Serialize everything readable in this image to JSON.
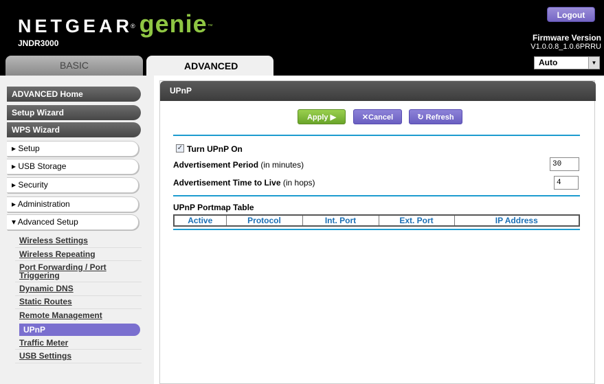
{
  "header": {
    "logo_brand": "NETGEAR",
    "logo_product": "genie",
    "model": "JNDR3000",
    "logout_label": "Logout",
    "firmware_label": "Firmware Version",
    "firmware_value": "V1.0.0.8_1.0.6PRRU",
    "tabs": [
      {
        "label": "BASIC",
        "active": false
      },
      {
        "label": "ADVANCED",
        "active": true
      }
    ],
    "language_selected": "Auto"
  },
  "sidebar": {
    "top_items": [
      {
        "label": "ADVANCED Home"
      },
      {
        "label": "Setup Wizard"
      },
      {
        "label": "WPS Wizard"
      }
    ],
    "sections": [
      {
        "label": "▸ Setup"
      },
      {
        "label": "▸ USB Storage"
      },
      {
        "label": "▸ Security"
      },
      {
        "label": "▸ Administration"
      },
      {
        "label": "▾ Advanced Setup"
      }
    ],
    "subitems": [
      {
        "label": "Wireless Settings"
      },
      {
        "label": "Wireless Repeating"
      },
      {
        "label": "Port Forwarding / Port Triggering"
      },
      {
        "label": "Dynamic DNS"
      },
      {
        "label": "Static Routes"
      },
      {
        "label": "Remote Management"
      },
      {
        "label": "UPnP"
      },
      {
        "label": "Traffic Meter"
      },
      {
        "label": "USB Settings"
      }
    ],
    "active_subitem": "UPnP"
  },
  "main": {
    "title": "UPnP",
    "apply_label": "Apply ▶",
    "cancel_label": "✕Cancel",
    "refresh_label": "↻ Refresh",
    "turn_on_label": "Turn UPnP On",
    "turn_on_checked": true,
    "adv_period_label": "Advertisement Period",
    "adv_period_unit": "(in minutes)",
    "adv_period_value": "30",
    "adv_ttl_label": "Advertisement Time to Live",
    "adv_ttl_unit": "(in hops)",
    "adv_ttl_value": "4",
    "portmap_title": "UPnP Portmap Table",
    "portmap_columns": [
      "Active",
      "Protocol",
      "Int. Port",
      "Ext. Port",
      "IP Address"
    ]
  },
  "colors": {
    "accent_blue": "#1d9bcf",
    "apply_green": "#7cb83a",
    "purple": "#7a6fcf",
    "genie_green": "#8fc643"
  }
}
